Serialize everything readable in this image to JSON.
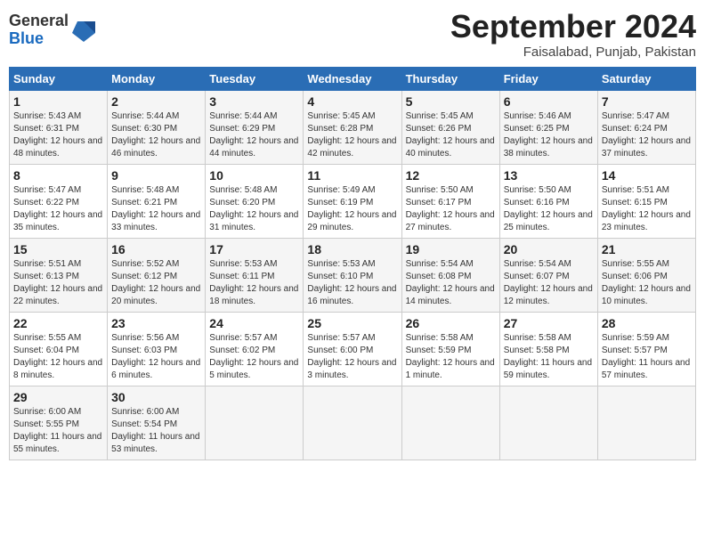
{
  "logo": {
    "general": "General",
    "blue": "Blue"
  },
  "title": "September 2024",
  "location": "Faisalabad, Punjab, Pakistan",
  "days_of_week": [
    "Sunday",
    "Monday",
    "Tuesday",
    "Wednesday",
    "Thursday",
    "Friday",
    "Saturday"
  ],
  "weeks": [
    [
      {
        "day": "1",
        "sunrise": "5:43 AM",
        "sunset": "6:31 PM",
        "daylight": "12 hours and 48 minutes."
      },
      {
        "day": "2",
        "sunrise": "5:44 AM",
        "sunset": "6:30 PM",
        "daylight": "12 hours and 46 minutes."
      },
      {
        "day": "3",
        "sunrise": "5:44 AM",
        "sunset": "6:29 PM",
        "daylight": "12 hours and 44 minutes."
      },
      {
        "day": "4",
        "sunrise": "5:45 AM",
        "sunset": "6:28 PM",
        "daylight": "12 hours and 42 minutes."
      },
      {
        "day": "5",
        "sunrise": "5:45 AM",
        "sunset": "6:26 PM",
        "daylight": "12 hours and 40 minutes."
      },
      {
        "day": "6",
        "sunrise": "5:46 AM",
        "sunset": "6:25 PM",
        "daylight": "12 hours and 38 minutes."
      },
      {
        "day": "7",
        "sunrise": "5:47 AM",
        "sunset": "6:24 PM",
        "daylight": "12 hours and 37 minutes."
      }
    ],
    [
      {
        "day": "8",
        "sunrise": "5:47 AM",
        "sunset": "6:22 PM",
        "daylight": "12 hours and 35 minutes."
      },
      {
        "day": "9",
        "sunrise": "5:48 AM",
        "sunset": "6:21 PM",
        "daylight": "12 hours and 33 minutes."
      },
      {
        "day": "10",
        "sunrise": "5:48 AM",
        "sunset": "6:20 PM",
        "daylight": "12 hours and 31 minutes."
      },
      {
        "day": "11",
        "sunrise": "5:49 AM",
        "sunset": "6:19 PM",
        "daylight": "12 hours and 29 minutes."
      },
      {
        "day": "12",
        "sunrise": "5:50 AM",
        "sunset": "6:17 PM",
        "daylight": "12 hours and 27 minutes."
      },
      {
        "day": "13",
        "sunrise": "5:50 AM",
        "sunset": "6:16 PM",
        "daylight": "12 hours and 25 minutes."
      },
      {
        "day": "14",
        "sunrise": "5:51 AM",
        "sunset": "6:15 PM",
        "daylight": "12 hours and 23 minutes."
      }
    ],
    [
      {
        "day": "15",
        "sunrise": "5:51 AM",
        "sunset": "6:13 PM",
        "daylight": "12 hours and 22 minutes."
      },
      {
        "day": "16",
        "sunrise": "5:52 AM",
        "sunset": "6:12 PM",
        "daylight": "12 hours and 20 minutes."
      },
      {
        "day": "17",
        "sunrise": "5:53 AM",
        "sunset": "6:11 PM",
        "daylight": "12 hours and 18 minutes."
      },
      {
        "day": "18",
        "sunrise": "5:53 AM",
        "sunset": "6:10 PM",
        "daylight": "12 hours and 16 minutes."
      },
      {
        "day": "19",
        "sunrise": "5:54 AM",
        "sunset": "6:08 PM",
        "daylight": "12 hours and 14 minutes."
      },
      {
        "day": "20",
        "sunrise": "5:54 AM",
        "sunset": "6:07 PM",
        "daylight": "12 hours and 12 minutes."
      },
      {
        "day": "21",
        "sunrise": "5:55 AM",
        "sunset": "6:06 PM",
        "daylight": "12 hours and 10 minutes."
      }
    ],
    [
      {
        "day": "22",
        "sunrise": "5:55 AM",
        "sunset": "6:04 PM",
        "daylight": "12 hours and 8 minutes."
      },
      {
        "day": "23",
        "sunrise": "5:56 AM",
        "sunset": "6:03 PM",
        "daylight": "12 hours and 6 minutes."
      },
      {
        "day": "24",
        "sunrise": "5:57 AM",
        "sunset": "6:02 PM",
        "daylight": "12 hours and 5 minutes."
      },
      {
        "day": "25",
        "sunrise": "5:57 AM",
        "sunset": "6:00 PM",
        "daylight": "12 hours and 3 minutes."
      },
      {
        "day": "26",
        "sunrise": "5:58 AM",
        "sunset": "5:59 PM",
        "daylight": "12 hours and 1 minute."
      },
      {
        "day": "27",
        "sunrise": "5:58 AM",
        "sunset": "5:58 PM",
        "daylight": "11 hours and 59 minutes."
      },
      {
        "day": "28",
        "sunrise": "5:59 AM",
        "sunset": "5:57 PM",
        "daylight": "11 hours and 57 minutes."
      }
    ],
    [
      {
        "day": "29",
        "sunrise": "6:00 AM",
        "sunset": "5:55 PM",
        "daylight": "11 hours and 55 minutes."
      },
      {
        "day": "30",
        "sunrise": "6:00 AM",
        "sunset": "5:54 PM",
        "daylight": "11 hours and 53 minutes."
      },
      null,
      null,
      null,
      null,
      null
    ]
  ]
}
